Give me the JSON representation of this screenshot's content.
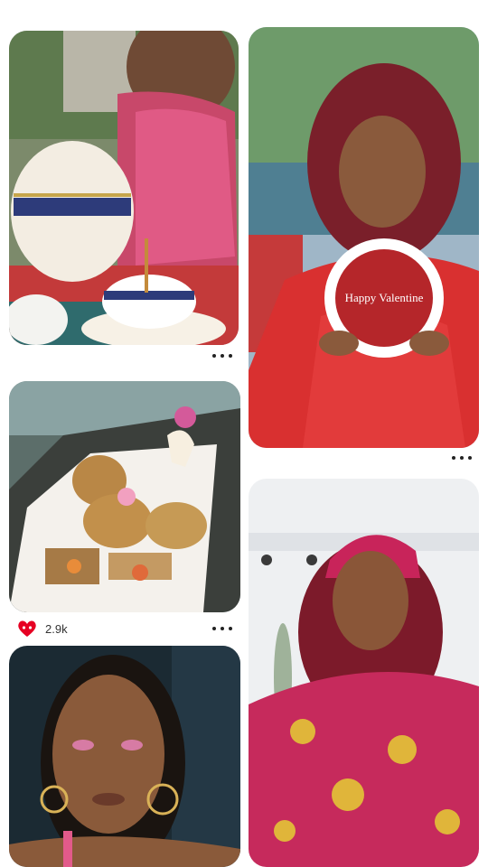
{
  "feed": {
    "colors": {
      "accent_red": "#e60023",
      "text": "#333333"
    },
    "pins": [
      {
        "name": "pin-tea-pouring",
        "overlay_text": ""
      },
      {
        "name": "pin-valentine-cake",
        "overlay_text": "Happy Valentine"
      },
      {
        "name": "pin-picnic-boat",
        "overlay_text": ""
      },
      {
        "name": "pin-headscarf-portrait",
        "overlay_text": ""
      },
      {
        "name": "pin-braids-portrait",
        "overlay_text": ""
      }
    ],
    "reaction": {
      "icon": "heart-eyes-icon",
      "count": "2.9k"
    }
  }
}
